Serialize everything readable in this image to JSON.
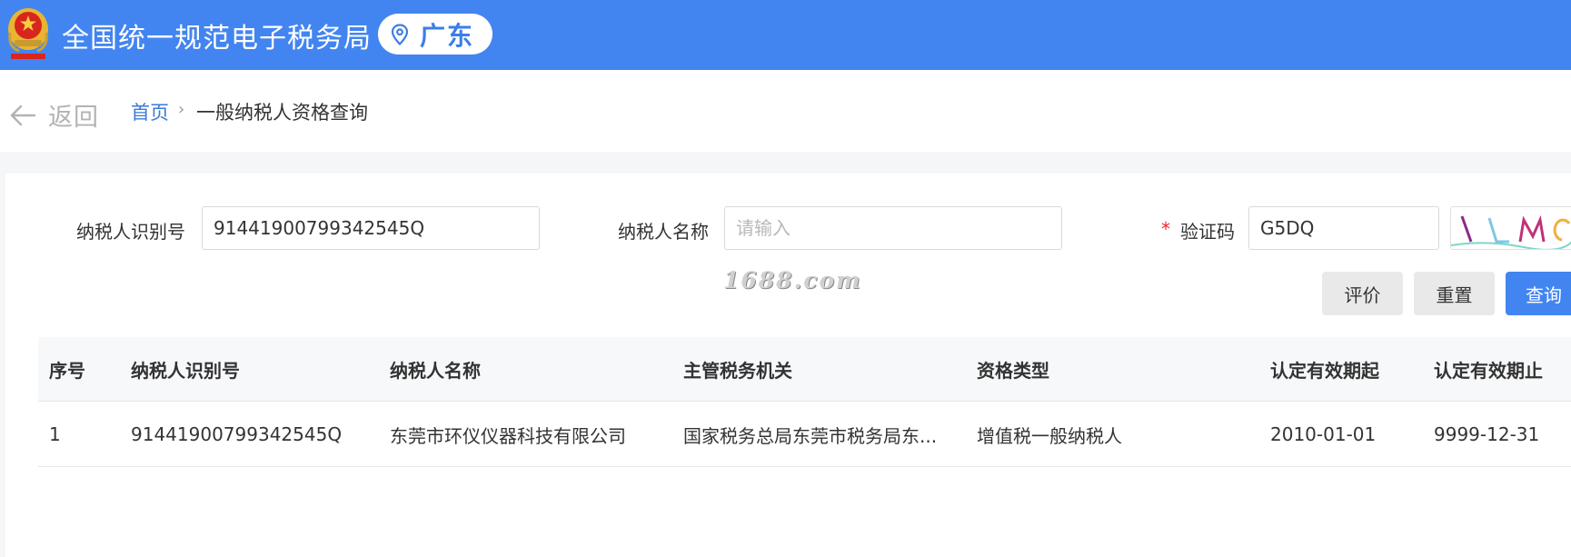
{
  "header": {
    "site_title": "全国统一规范电子税务局",
    "region": "广东",
    "colors": {
      "primary": "#4385f0",
      "emblem_red": "#d7261e",
      "emblem_gold": "#e9b531"
    }
  },
  "nav": {
    "back_label": "返回",
    "breadcrumb": {
      "home": "首页",
      "separator": "›",
      "current": "一般纳税人资格查询"
    }
  },
  "form": {
    "taxpayer_id": {
      "label": "纳税人识别号",
      "value": "91441900799342545Q",
      "placeholder": ""
    },
    "taxpayer_name": {
      "label": "纳税人名称",
      "value": "",
      "placeholder": "请输入"
    },
    "captcha": {
      "required_mark": "*",
      "label": "验证码",
      "value": "G5DQ"
    }
  },
  "watermark": "1688.com",
  "actions": {
    "evaluate": "评价",
    "reset": "重置",
    "query": "查询"
  },
  "table": {
    "columns": [
      "序号",
      "纳税人识别号",
      "纳税人名称",
      "主管税务机关",
      "资格类型",
      "认定有效期起",
      "认定有效期止"
    ],
    "rows": [
      [
        "1",
        "91441900799342545Q",
        "东莞市环仪仪器科技有限公司",
        "国家税务总局东莞市税务局东...",
        "增值税一般纳税人",
        "2010-01-01",
        "9999-12-31"
      ]
    ]
  },
  "icons": [
    "tax-emblem-icon",
    "location-pin-icon",
    "back-arrow-icon",
    "captcha-image"
  ]
}
